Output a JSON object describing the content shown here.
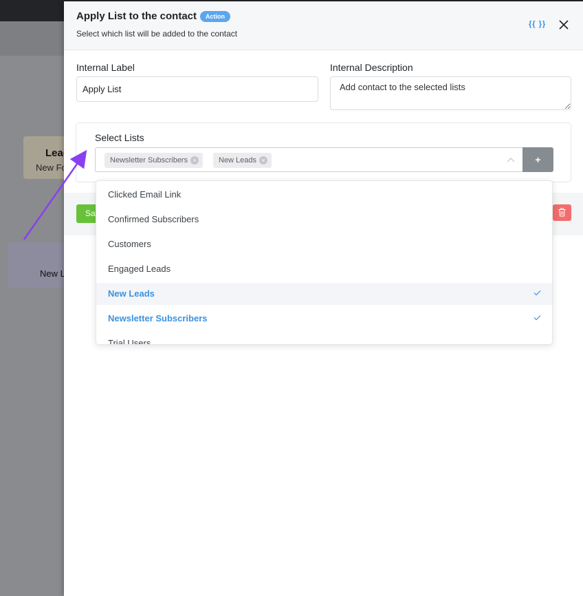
{
  "background": {
    "lead_card": {
      "title": "Lead",
      "subtitle": "New Fo"
    },
    "new_card": {
      "title": "New L"
    }
  },
  "drawer": {
    "title": "Apply List to the contact",
    "badge": "Action",
    "subtitle": "Select which list will be added to the contact",
    "smartcode_label": "{{ }}",
    "internal_label": {
      "label": "Internal Label",
      "value": "Apply List"
    },
    "internal_description": {
      "label": "Internal Description",
      "value": "Add contact to the selected lists"
    },
    "select_lists": {
      "label": "Select Lists",
      "selected_tags": [
        "Newsletter Subscribers",
        "New Leads"
      ],
      "add_button": "+"
    },
    "save_button": "Sa",
    "dropdown_options": [
      {
        "label": "Clicked Email Link",
        "selected": false
      },
      {
        "label": "Confirmed Subscribers",
        "selected": false
      },
      {
        "label": "Customers",
        "selected": false
      },
      {
        "label": "Engaged Leads",
        "selected": false
      },
      {
        "label": "New Leads",
        "selected": true
      },
      {
        "label": "Newsletter Subscribers",
        "selected": true
      },
      {
        "label": "Trial Users",
        "selected": false
      }
    ],
    "colors": {
      "accent": "#3a92e0",
      "badge": "#5aa7ef",
      "save": "#67c23a",
      "delete": "#f26d6d",
      "annotation_arrow": "#8a3ff0"
    }
  }
}
